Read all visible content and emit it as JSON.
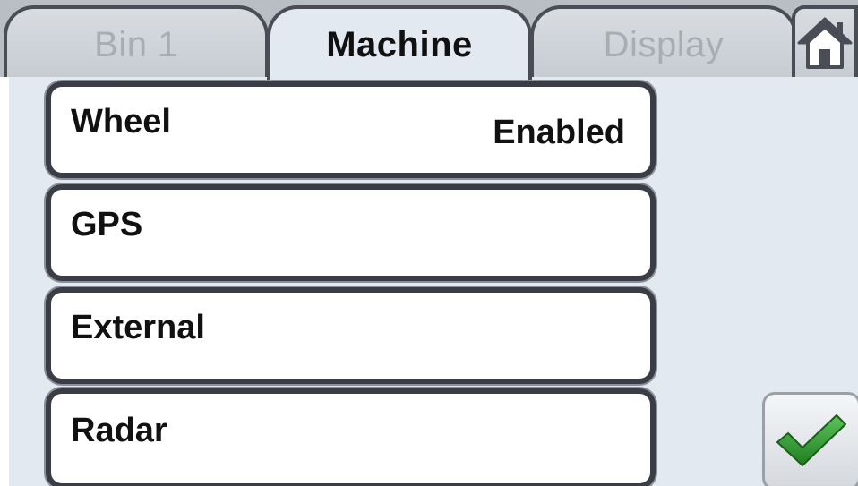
{
  "tabs": {
    "bin": "Bin 1",
    "machine": "Machine",
    "display": "Display"
  },
  "active_tab": "Machine",
  "icons": {
    "home": "home-icon",
    "confirm": "checkmark-icon"
  },
  "colors": {
    "checkmark": "#2f9e2f",
    "row_border": "#3a3d45",
    "tab_active_text": "#111111",
    "tab_inactive_text": "#a8adb4"
  },
  "speed_sources": [
    {
      "label": "Wheel",
      "status": "Enabled"
    },
    {
      "label": "GPS",
      "status": ""
    },
    {
      "label": "External",
      "status": ""
    },
    {
      "label": "Radar",
      "status": ""
    }
  ]
}
